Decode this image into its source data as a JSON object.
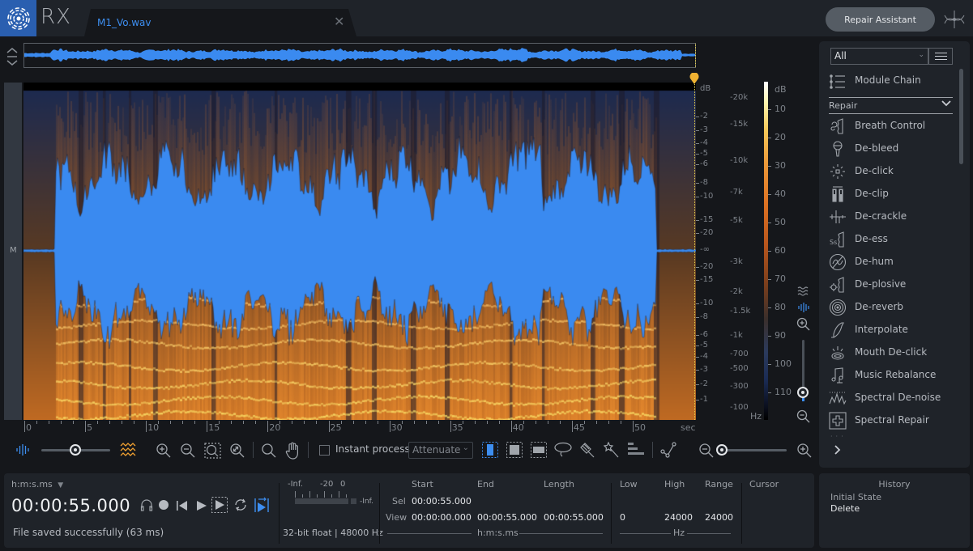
{
  "app": {
    "name": "RX",
    "logo_icon": "izotope-logo-icon",
    "file_tab": {
      "label": "M1_Vo.wav",
      "close_icon": "close-icon"
    },
    "repair_assistant_label": "Repair Assistant",
    "connect_icon": "connect-icon"
  },
  "colors": {
    "accent": "#3d8ef0",
    "waveform": "#3a8af0",
    "playhead": "#f0b232",
    "spectrogram_hot": "#f5a53a",
    "spectrogram_cold": "#1a2a55",
    "logo_bg": "#2a5fb0"
  },
  "editor": {
    "channel_label": "M",
    "db_axis": {
      "unit": "dB",
      "upper_ticks": [
        "-2",
        "-3",
        "-4",
        "-5",
        "-6",
        "-8",
        "-10",
        "-15",
        "-20"
      ],
      "center": "-∞",
      "lower_ticks": [
        "-20",
        "-15",
        "-10",
        "-8",
        "-6",
        "-5",
        "-4",
        "-3",
        "-2",
        "-1"
      ]
    },
    "freq_axis": {
      "unit": "Hz",
      "ticks": [
        "-20k",
        "-15k",
        "-10k",
        "-7k",
        "-5k",
        "-3k",
        "-2k",
        "-1.5k",
        "-1k",
        "-700",
        "-500",
        "-300",
        "-100"
      ]
    },
    "colorbar": {
      "unit": "dB",
      "ticks": [
        "10",
        "20",
        "30",
        "40",
        "50",
        "60",
        "70",
        "80",
        "90",
        "100",
        "110"
      ]
    },
    "time_axis": {
      "unit": "sec",
      "ticks": [
        "0",
        "5",
        "10",
        "15",
        "20",
        "25",
        "30",
        "35",
        "40",
        "45",
        "50"
      ]
    },
    "playhead_time_sec": 55
  },
  "toolbar": {
    "instant_process_label": "Instant process",
    "instant_process_checked": false,
    "mode_select_value": "Attenuate",
    "waveform_spectrogram_blend": 0.55,
    "horizontal_zoom": 0.0
  },
  "module_panel": {
    "filter_value": "All",
    "module_chain_label": "Module Chain",
    "category_label": "Repair",
    "modules": [
      {
        "label": "Breath Control",
        "icon": "breath-control-icon"
      },
      {
        "label": "De-bleed",
        "icon": "microphone-icon"
      },
      {
        "label": "De-click",
        "icon": "click-burst-icon"
      },
      {
        "label": "De-clip",
        "icon": "de-clip-icon"
      },
      {
        "label": "De-crackle",
        "icon": "crackle-icon"
      },
      {
        "label": "De-ess",
        "icon": "de-ess-icon"
      },
      {
        "label": "De-hum",
        "icon": "hum-icon"
      },
      {
        "label": "De-plosive",
        "icon": "plosive-icon"
      },
      {
        "label": "De-reverb",
        "icon": "reverb-icon"
      },
      {
        "label": "Interpolate",
        "icon": "interpolate-icon"
      },
      {
        "label": "Mouth De-click",
        "icon": "mouth-icon"
      },
      {
        "label": "Music Rebalance",
        "icon": "music-note-icon"
      },
      {
        "label": "Spectral De-noise",
        "icon": "spectral-denoise-icon"
      },
      {
        "label": "Spectral Repair",
        "icon": "spectral-repair-icon"
      }
    ]
  },
  "transport": {
    "time_format": "h:m:s.ms",
    "current_time": "00:00:55.000",
    "status": "File saved successfully (63 ms)",
    "meter": {
      "scale": [
        "-Inf.",
        "-20",
        "0"
      ],
      "peak": "-Inf."
    },
    "format": "32-bit float | 48000 Hz"
  },
  "selection": {
    "headers": [
      "Start",
      "End",
      "Length"
    ],
    "rows": [
      {
        "label": "Sel",
        "start": "00:00:55.000",
        "end": "",
        "length": ""
      },
      {
        "label": "View",
        "start": "00:00:00.000",
        "end": "00:00:55.000",
        "length": "00:00:55.000"
      }
    ],
    "unit": "h:m:s.ms"
  },
  "frequency": {
    "headers": [
      "Low",
      "High",
      "Range"
    ],
    "values": [
      "0",
      "24000",
      "24000"
    ],
    "unit": "Hz"
  },
  "cursor": {
    "label": "Cursor"
  },
  "history": {
    "title": "History",
    "items": [
      "Initial State",
      "Delete"
    ]
  }
}
